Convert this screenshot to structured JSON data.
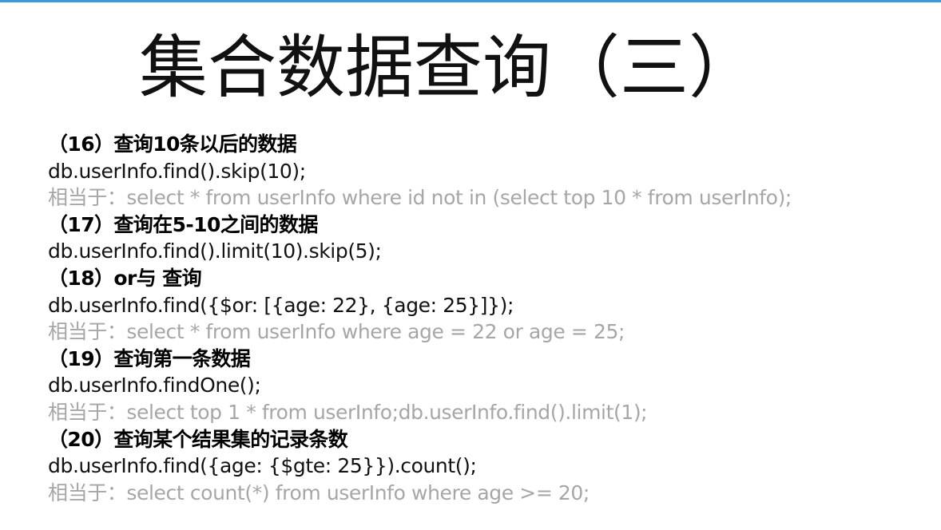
{
  "slide": {
    "title": "集合数据查询（三）",
    "items": [
      {
        "heading": "（16）查询10条以后的数据",
        "code": "db.userInfo.find().skip(10);",
        "equivalent": "相当于：select * from userInfo where id not in (select top 10 * from userInfo);"
      },
      {
        "heading": "（17）查询在5-10之间的数据",
        "code": "db.userInfo.find().limit(10).skip(5);",
        "equivalent": null
      },
      {
        "heading": "（18）or与 查询",
        "code": "db.userInfo.find({$or: [{age: 22}, {age: 25}]});",
        "equivalent": "相当于：select * from userInfo where age = 22 or age = 25;"
      },
      {
        "heading": "（19）查询第一条数据",
        "code": "db.userInfo.findOne();",
        "equivalent": "相当于：select top 1 * from userInfo;db.userInfo.find().limit(1);"
      },
      {
        "heading": "（20）查询某个结果集的记录条数",
        "code": "db.userInfo.find({age: {$gte: 25}}).count();",
        "equivalent": "相当于：select count(*) from userInfo where age >= 20;"
      }
    ]
  },
  "colors": {
    "accent_rule": "#3a9ad9",
    "heading_text": "#000000",
    "code_text": "#111111",
    "equivalent_text": "#a6a6a6"
  }
}
